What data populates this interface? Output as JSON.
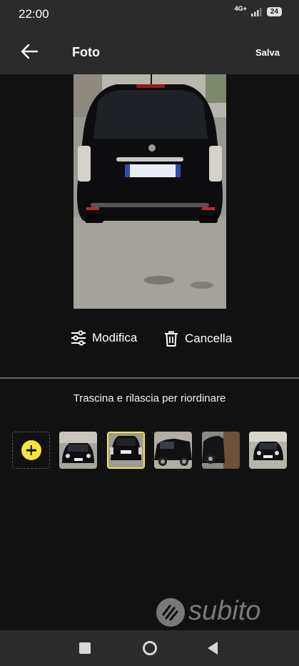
{
  "status_bar": {
    "time": "22:00",
    "network": "4G+",
    "battery": "24"
  },
  "app_bar": {
    "title": "Foto",
    "save_label": "Salva"
  },
  "photo_actions": {
    "edit_label": "Modifica",
    "delete_label": "Cancella"
  },
  "reorder_hint": "Trascina e rilascia per riordinare",
  "thumbnails": {
    "count": 6,
    "selected_index": 1
  },
  "watermark": "subito",
  "colors": {
    "accent": "#f7e63b",
    "background": "#111111",
    "bar": "#2b2b2b"
  },
  "icons": [
    "back-arrow-icon",
    "sliders-icon",
    "trash-icon",
    "plus-icon",
    "square-icon",
    "circle-icon",
    "triangle-back-icon"
  ]
}
